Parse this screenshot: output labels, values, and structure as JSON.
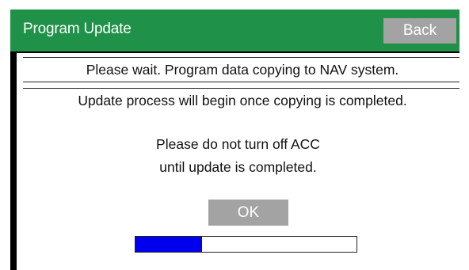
{
  "header": {
    "title": "Program Update",
    "back_label": "Back"
  },
  "status": {
    "line1": "Please wait. Program data copying to NAV system.",
    "line2": "Update process will begin once copying is completed."
  },
  "notice": {
    "line1": "Please do not turn off ACC",
    "line2": "until update is completed."
  },
  "dialog": {
    "ok_label": "OK"
  },
  "progress": {
    "fraction": 0.3
  },
  "colors": {
    "header_background": "#1f9148",
    "button_background": "#a3a3a3",
    "progress_fill": "#0000ee"
  }
}
